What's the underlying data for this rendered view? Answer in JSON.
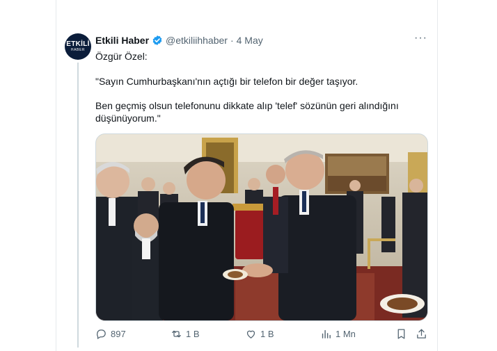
{
  "tweet": {
    "author_name": "Etkili Haber",
    "handle": "@etkiliihhaber",
    "separator": "·",
    "date": "4 May",
    "avatar": {
      "line1": "ETKİLİ",
      "line2": "HABER"
    },
    "subject": "Özgür Özel:",
    "paragraphs": [
      "\"Sayın Cumhurbaşkanı'nın açtığı bir telefon bir değer taşıyor.",
      "Ben geçmiş olsun telefonunu dikkate alıp 'telef' sözünün geri alındığını düşünüyorum.\""
    ],
    "more_label": "···",
    "verified_icon": "verified-badge-icon",
    "accent_color": "#1d9bf0"
  },
  "actions": {
    "replies": "897",
    "retweets": "1 B",
    "likes": "1 B",
    "views": "1 Mn",
    "icons": [
      "reply-icon",
      "retweet-icon",
      "like-icon",
      "views-icon",
      "bookmark-icon",
      "share-icon"
    ]
  }
}
